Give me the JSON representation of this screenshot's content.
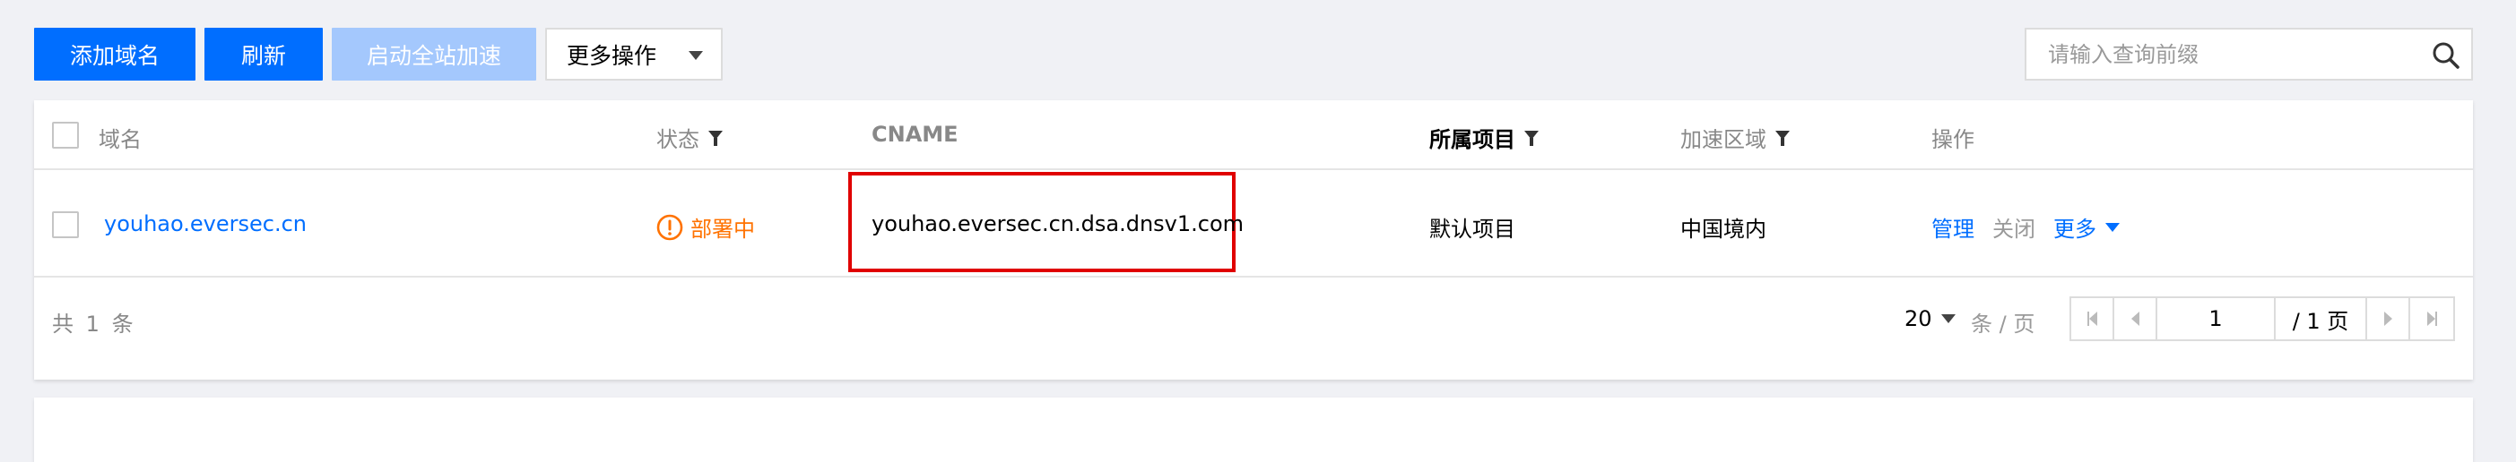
{
  "toolbar": {
    "add_domain": "添加域名",
    "refresh": "刷新",
    "enable_full_site": "启动全站加速",
    "more_actions": "更多操作"
  },
  "search": {
    "placeholder": "请输入查询前缀"
  },
  "table": {
    "headers": {
      "domain": "域名",
      "status": "状态",
      "cname": "CNAME",
      "project": "所属项目",
      "region": "加速区域",
      "actions": "操作"
    },
    "rows": [
      {
        "domain": "youhao.eversec.cn",
        "status": "部署中",
        "cname": "youhao.eversec.cn.dsa.dnsv1.com",
        "project": "默认项目",
        "region": "中国境内",
        "actions": {
          "manage": "管理",
          "close": "关闭",
          "more": "更多"
        }
      }
    ]
  },
  "footer": {
    "total_prefix": "共",
    "total_count": "1",
    "total_suffix": "条",
    "page_size": "20",
    "page_size_unit": "条 / 页",
    "current_page": "1",
    "total_pages_text": "/ 1 页"
  },
  "colors": {
    "primary": "#006eff",
    "disabled": "#a4c8fd",
    "warning": "#ff7200",
    "highlight_border": "#e00000"
  },
  "icons": {
    "search": "search-icon",
    "status": "exclamation-circle-icon",
    "filter": "filter-icon",
    "dropdown": "caret-down-icon"
  }
}
